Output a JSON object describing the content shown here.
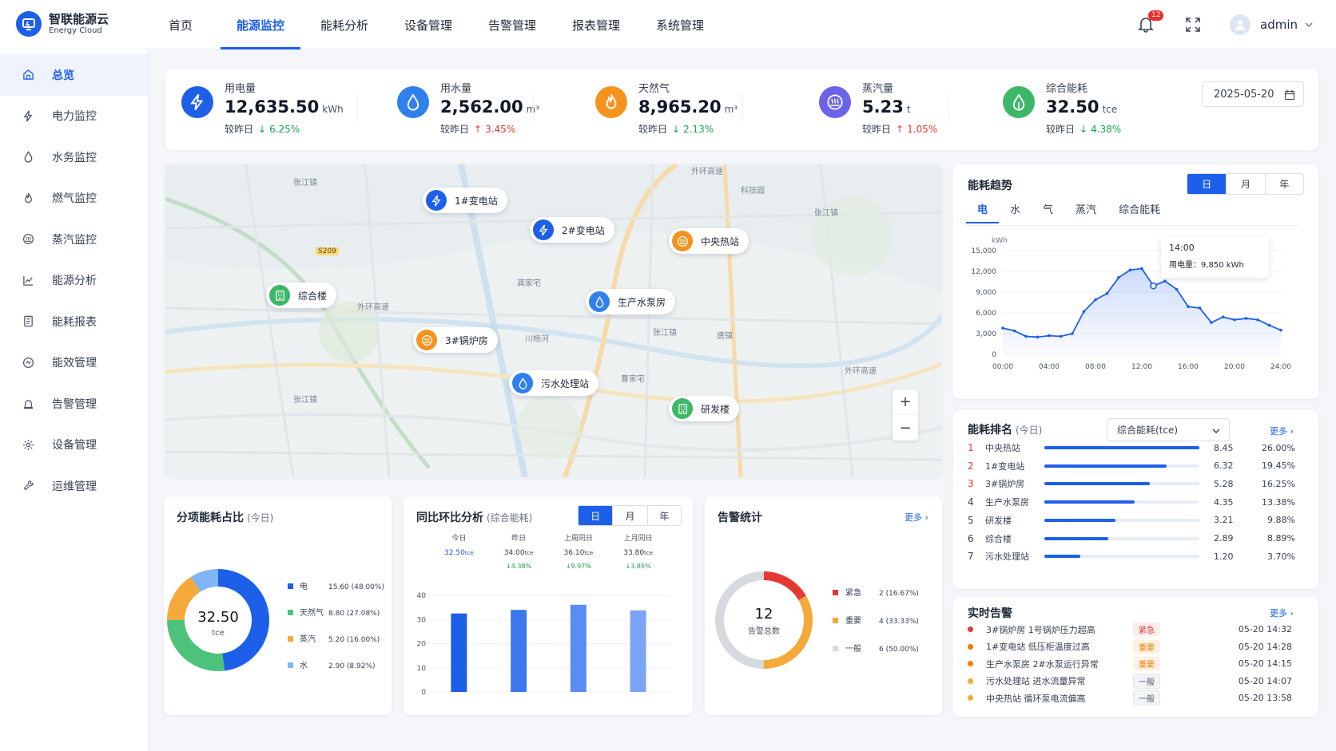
{
  "app": {
    "name": "智联能源云",
    "name_en": "Energy Cloud",
    "user": "admin",
    "notifications": "12"
  },
  "top_tabs": [
    {
      "label": "首页"
    },
    {
      "label": "能源监控"
    },
    {
      "label": "能耗分析"
    },
    {
      "label": "设备管理"
    },
    {
      "label": "告警管理"
    },
    {
      "label": "报表管理"
    },
    {
      "label": "系统管理"
    }
  ],
  "active_top_tab": "能源监控",
  "sidebar": [
    {
      "label": "总览",
      "icon": "home-icon"
    },
    {
      "label": "电力监控",
      "icon": "bolt-icon"
    },
    {
      "label": "水务监控",
      "icon": "drop-icon"
    },
    {
      "label": "燃气监控",
      "icon": "flame-icon"
    },
    {
      "label": "蒸汽监控",
      "icon": "steam-icon"
    },
    {
      "label": "能源分析",
      "icon": "chart-icon"
    },
    {
      "label": "能耗报表",
      "icon": "report-icon"
    },
    {
      "label": "能效管理",
      "icon": "efficiency-icon"
    },
    {
      "label": "告警管理",
      "icon": "alarm-icon"
    },
    {
      "label": "设备管理",
      "icon": "device-icon"
    },
    {
      "label": "运维管理",
      "icon": "maintain-icon"
    }
  ],
  "kpis": [
    {
      "name": "用电量",
      "value": "12,635.50",
      "unit": "kWh",
      "cmp_label": "较昨日",
      "arrow": "↓",
      "change": "6.25%",
      "dir": "down",
      "color": "#1d5fe8",
      "icon": "bolt-icon"
    },
    {
      "name": "用水量",
      "value": "2,562.00",
      "unit": "m³",
      "cmp_label": "较昨日",
      "arrow": "↑",
      "change": "3.45%",
      "dir": "up",
      "color": "#2f80ed",
      "icon": "drop-icon"
    },
    {
      "name": "天然气",
      "value": "8,965.20",
      "unit": "m³",
      "cmp_label": "较昨日",
      "arrow": "↓",
      "change": "2.13%",
      "dir": "down",
      "color": "#f6921e",
      "icon": "flame-icon"
    },
    {
      "name": "蒸汽量",
      "value": "5.23",
      "unit": "t",
      "cmp_label": "较昨日",
      "arrow": "↑",
      "change": "1.05%",
      "dir": "up",
      "color": "#6c63e8",
      "icon": "steam-icon"
    },
    {
      "name": "综合能耗",
      "value": "32.50",
      "unit": "tce",
      "cmp_label": "较昨日",
      "arrow": "↓",
      "change": "4.38%",
      "dir": "down",
      "color": "#3cb867",
      "icon": "leaf-icon"
    }
  ],
  "date": "2025-05-20",
  "map": {
    "stations": [
      {
        "label": "1#变电站",
        "color": "#1d5fe8",
        "icon": "bolt-icon"
      },
      {
        "label": "2#变电站",
        "color": "#1d5fe8",
        "icon": "bolt-icon"
      },
      {
        "label": "中央热站",
        "color": "#f6921e",
        "icon": "steam-icon"
      },
      {
        "label": "综合楼",
        "color": "#3cb867",
        "icon": "building-icon"
      },
      {
        "label": "生产水泵房",
        "color": "#2f80ed",
        "icon": "drop-icon"
      },
      {
        "label": "3#锅炉房",
        "color": "#f6921e",
        "icon": "steam-icon"
      },
      {
        "label": "污水处理站",
        "color": "#2f80ed",
        "icon": "drop-icon"
      },
      {
        "label": "研发楼",
        "color": "#3cb867",
        "icon": "building-icon"
      }
    ],
    "place_names": [
      "张江镇",
      "科技园",
      "张江镇",
      "龚家宅",
      "外环高速",
      "川杨河",
      "S209",
      "外环高速",
      "张江镇",
      "唐镇",
      "曹家宅",
      "张江镇",
      "外环高速"
    ],
    "zoom_in": "+",
    "zoom_out": "−"
  },
  "trend": {
    "title": "能耗趋势",
    "periods": [
      "日",
      "月",
      "年"
    ],
    "active_period": "日",
    "energy_tabs": [
      "电",
      "水",
      "气",
      "蒸汽",
      "综合能耗"
    ],
    "active_energy": "电",
    "tooltip": {
      "time": "14:00",
      "label": "用电量：",
      "value": "9,850 kWh"
    }
  },
  "chart_data": [
    {
      "type": "area",
      "title": "能耗趋势",
      "ylabel": "kWh",
      "x_ticks": [
        "00:00",
        "04:00",
        "08:00",
        "12:00",
        "16:00",
        "20:00",
        "24:00"
      ],
      "y_ticks": [
        "0",
        "3,000",
        "6,000",
        "9,000",
        "12,000",
        "15,000"
      ],
      "xlim": [
        0,
        24
      ],
      "ylim": [
        0,
        15000
      ],
      "x": [
        0,
        1,
        2,
        3,
        4,
        5,
        6,
        7,
        8,
        9,
        10,
        11,
        12,
        13,
        14,
        15,
        16,
        17,
        18,
        19,
        20,
        21,
        22,
        23,
        24
      ],
      "y": [
        3800,
        3400,
        2600,
        2500,
        2700,
        2600,
        3000,
        6200,
        7900,
        8800,
        11100,
        12200,
        12400,
        9900,
        10600,
        9400,
        6900,
        6700,
        4600,
        5400,
        5000,
        5200,
        5000,
        4200,
        3500
      ],
      "series": [
        {
          "name": "用电量",
          "color": "#1d5fe8"
        }
      ]
    },
    {
      "type": "pie",
      "title": "分项能耗占比",
      "center_value": "32.50",
      "center_unit": "tce",
      "categories": [
        "电",
        "天然气",
        "蒸汽",
        "水"
      ],
      "values": [
        15.6,
        8.8,
        5.2,
        2.9
      ],
      "labels": [
        "15.60 (48.00%)",
        "8.80 (27.08%)",
        "5.20 (16.00%)",
        "2.90 (8.92%)"
      ],
      "colors": [
        "#1d5fe8",
        "#4cc27a",
        "#f6a93b",
        "#7fb5f5"
      ]
    },
    {
      "type": "bar",
      "title": "同比环比分析",
      "categories": [
        "今日",
        "昨日",
        "上周同日",
        "上月同日"
      ],
      "values": [
        32.5,
        34.0,
        36.1,
        33.8
      ],
      "value_labels": [
        "32.50",
        "34.00",
        "36.10",
        "33.80"
      ],
      "unit": "tce",
      "changes": [
        "",
        "↓4.38%",
        "↓9.97%",
        "↓3.85%"
      ],
      "ylim": [
        0,
        40
      ],
      "y_ticks": [
        "0",
        "10",
        "20",
        "30",
        "40"
      ],
      "colors": [
        "#1d5fe8",
        "#3d78ef",
        "#5a8cf2",
        "#7aa4f5"
      ]
    },
    {
      "type": "pie",
      "title": "告警统计",
      "center_value": "12",
      "center_label": "告警总数",
      "categories": [
        "紧急",
        "重要",
        "一般"
      ],
      "values": [
        2,
        4,
        6
      ],
      "labels": [
        "2 (16.67%)",
        "4 (33.33%)",
        "6 (50.00%)"
      ],
      "colors": [
        "#e53935",
        "#f6a93b",
        "#d6d9de"
      ]
    }
  ],
  "breakdown": {
    "title": "分项能耗占比",
    "sub": "(今日)"
  },
  "compare": {
    "title": "同比环比分析",
    "sub": "(综合能耗)",
    "periods": [
      "日",
      "月",
      "年"
    ],
    "active_period": "日"
  },
  "alarm_stats": {
    "title": "告警统计",
    "more": "更多"
  },
  "ranking": {
    "title": "能耗排名",
    "sub": "(今日)",
    "select": "综合能耗(tce)",
    "more": "更多",
    "rows": [
      {
        "no": "1",
        "name": "中央热站",
        "value": "8.45",
        "pct": "26.00%",
        "ratio": 1.0
      },
      {
        "no": "2",
        "name": "1#变电站",
        "value": "6.32",
        "pct": "19.45%",
        "ratio": 0.79
      },
      {
        "no": "3",
        "name": "3#锅炉房",
        "value": "5.28",
        "pct": "16.25%",
        "ratio": 0.68
      },
      {
        "no": "4",
        "name": "生产水泵房",
        "value": "4.35",
        "pct": "13.38%",
        "ratio": 0.58
      },
      {
        "no": "5",
        "name": "研发楼",
        "value": "3.21",
        "pct": "9.88%",
        "ratio": 0.46
      },
      {
        "no": "6",
        "name": "综合楼",
        "value": "2.89",
        "pct": "8.89%",
        "ratio": 0.41
      },
      {
        "no": "7",
        "name": "污水处理站",
        "value": "1.20",
        "pct": "3.70%",
        "ratio": 0.23
      }
    ]
  },
  "realtime_alarms": {
    "title": "实时告警",
    "more": "更多",
    "rows": [
      {
        "text": "3#锅炉房  1号锅炉压力超高",
        "level": "紧急",
        "time": "05-20 14:32",
        "color": "#e53935",
        "cls": "t1"
      },
      {
        "text": "1#变电站  低压柜温度过高",
        "level": "重要",
        "time": "05-20 14:28",
        "color": "#f57c00",
        "cls": "t2"
      },
      {
        "text": "生产水泵房  2#水泵运行异常",
        "level": "重要",
        "time": "05-20 14:15",
        "color": "#f57c00",
        "cls": "t2"
      },
      {
        "text": "污水处理站  进水流量异常",
        "level": "一般",
        "time": "05-20 14:07",
        "color": "#f6a93b",
        "cls": "t3"
      },
      {
        "text": "中央热站  循环泵电流偏高",
        "level": "一般",
        "time": "05-20 13:58",
        "color": "#f6a93b",
        "cls": "t3"
      }
    ]
  }
}
